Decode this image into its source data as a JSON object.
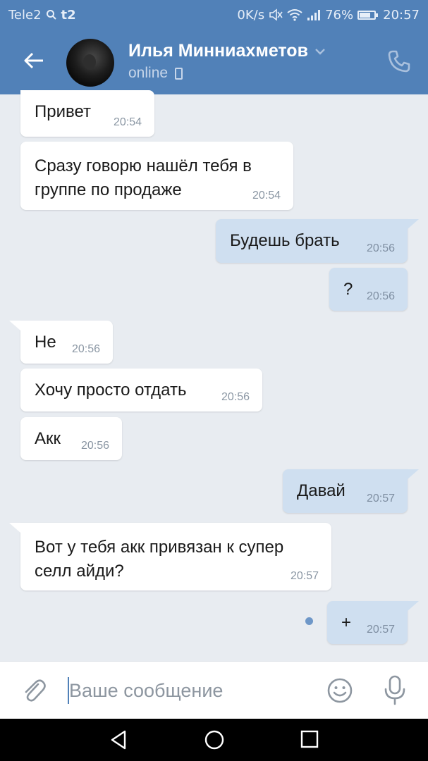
{
  "status_bar": {
    "carrier": "Tele2",
    "carrier_badge": "t2",
    "speed": "0K/s",
    "battery": "76%",
    "battery_level": 0.76,
    "time": "20:57",
    "icons": [
      "search-icon",
      "mute-icon",
      "wifi-icon",
      "signal-icon",
      "battery-icon"
    ]
  },
  "header": {
    "name": "Илья Минниахметов",
    "status": "online",
    "icons": [
      "back-arrow-icon",
      "chevron-down-icon",
      "mobile-device-icon",
      "call-icon"
    ]
  },
  "messages": [
    {
      "direction": "in",
      "text": "Привет",
      "time": "20:54"
    },
    {
      "direction": "in",
      "text": "Сразу говорю нашёл тебя в группе по продаже",
      "time": "20:54"
    },
    {
      "direction": "out",
      "text": "Будешь брать",
      "time": "20:56"
    },
    {
      "direction": "out",
      "text": "?",
      "time": "20:56"
    },
    {
      "direction": "in",
      "text": "Не",
      "time": "20:56"
    },
    {
      "direction": "in",
      "text": "Хочу просто отдать",
      "time": "20:56"
    },
    {
      "direction": "in",
      "text": "Акк",
      "time": "20:56"
    },
    {
      "direction": "out",
      "text": "Давай",
      "time": "20:57"
    },
    {
      "direction": "in",
      "text": "Вот у тебя акк привязан к супер селл айди?",
      "time": "20:57"
    },
    {
      "direction": "out",
      "text": "+",
      "time": "20:57",
      "unread": true
    }
  ],
  "composer": {
    "placeholder": "Ваше сообщение",
    "icons": [
      "attach-icon",
      "emoji-icon",
      "microphone-icon"
    ]
  },
  "nav": {
    "icons": [
      "nav-back-icon",
      "nav-home-icon",
      "nav-recent-icon"
    ]
  },
  "colors": {
    "accent": "#5181b8",
    "background": "#e8ecf1",
    "incoming_bubble": "#ffffff",
    "outgoing_bubble": "#cfdff0"
  }
}
